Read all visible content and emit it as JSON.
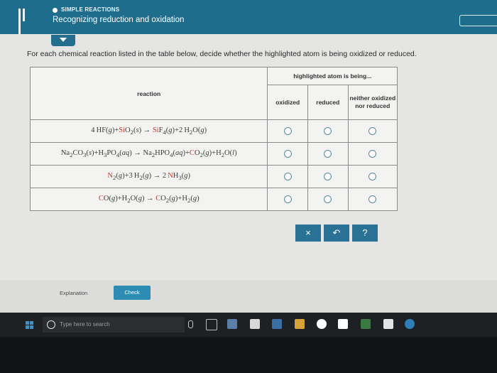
{
  "header": {
    "section_label": "SIMPLE REACTIONS",
    "title": "Recognizing reduction and oxidation"
  },
  "instruction": "For each chemical reaction listed in the table below, decide whether the highlighted atom is being oxidized or reduced.",
  "table": {
    "reaction_header": "reaction",
    "group_header": "highlighted atom is being...",
    "col_oxidized": "oxidized",
    "col_reduced": "reduced",
    "col_neither": "neither oxidized nor reduced",
    "rows": [
      {
        "html": "4&thinsp;HF(<i>g</i>)+<span class=\"hl\">Si</span>O<sub>2</sub>(<i>s</i>) &rarr; <span class=\"hl\">Si</span>F<sub>4</sub>(<i>g</i>)+2&thinsp;H<sub>2</sub>O(<i>g</i>)"
      },
      {
        "html": "Na<sub>2</sub>CO<sub>3</sub>(<i>s</i>)+H<sub>3</sub>PO<sub>4</sub>(<i>aq</i>) &rarr; Na<sub>2</sub>HPO<sub>4</sub>(<i>aq</i>)+<span class=\"hl\">C</span>O<sub>2</sub>(<i>g</i>)+H<sub>2</sub>O(<i>l</i>)"
      },
      {
        "html": "<span class=\"hl\">N</span><sub>2</sub>(<i>g</i>)+3&thinsp;H<sub>2</sub>(<i>g</i>) &rarr; 2&thinsp;<span class=\"hl\">N</span>H<sub>3</sub>(<i>g</i>)"
      },
      {
        "html": "<span class=\"hl\">C</span>O(<i>g</i>)+H<sub>2</sub>O(<i>g</i>) &rarr; <span class=\"hl\">C</span>O<sub>2</sub>(<i>g</i>)+H<sub>2</sub>(<i>g</i>)"
      }
    ]
  },
  "actions": {
    "clear": "×",
    "undo": "↶",
    "help": "?"
  },
  "footer": {
    "explanation": "Explanation",
    "check": "Check"
  },
  "taskbar": {
    "search_placeholder": "Type here to search"
  },
  "colors": {
    "header": "#1f6d8c",
    "accent": "#2a7295",
    "highlight": "#c03a2b"
  }
}
